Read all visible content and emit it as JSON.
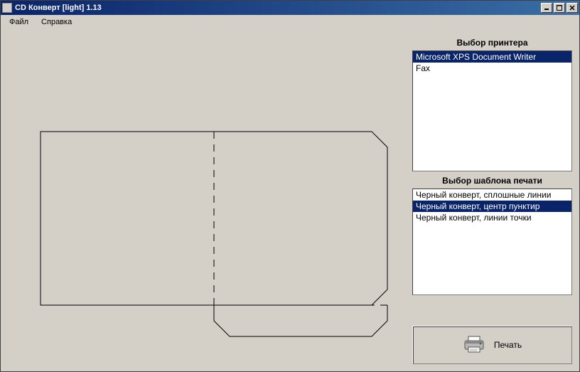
{
  "window": {
    "title": "CD Конверт [light] 1.13"
  },
  "menu": {
    "file": "Файл",
    "help": "Справка"
  },
  "printer": {
    "label": "Выбор принтера",
    "items": [
      "Microsoft XPS Document Writer",
      "Fax"
    ],
    "selected": 0
  },
  "template": {
    "label": "Выбор шаблона печати",
    "items": [
      "Черный конверт, сплошные линии",
      "Черный конверт, центр пунктир",
      "Черный конверт, линии точки"
    ],
    "selected": 1
  },
  "print_button": {
    "label": "Печать"
  }
}
